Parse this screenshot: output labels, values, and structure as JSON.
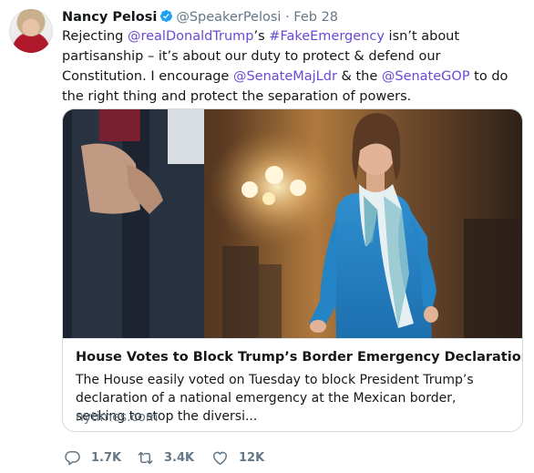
{
  "tweet": {
    "author_name": "Nancy Pelosi",
    "handle": "@SpeakerPelosi",
    "separator": "·",
    "date": "Feb 28",
    "text_parts": {
      "p1": "Rejecting ",
      "mention1": "@realDonaldTrump",
      "p2": "’s ",
      "hashtag": "#FakeEmergency",
      "p3": " isn’t about partisanship – it’s about our duty to protect & defend our Constitution. I encourage ",
      "mention2": "@SenateMajLdr",
      "p4": " & the ",
      "mention3": "@SenateGOP",
      "p5": " to do the right thing and protect the separation of powers."
    }
  },
  "card": {
    "title": "House Votes to Block Trump’s Border Emergency Declaration",
    "description": "The House easily voted on Tuesday to block President Trump’s declaration of a national emergency at the Mexican border, seeking to stop the diversi...",
    "domain": "nytimes.com"
  },
  "actions": {
    "replies": "1.7K",
    "retweets": "3.4K",
    "likes": "12K"
  },
  "colors": {
    "link": "#6a49d6",
    "muted": "#657786",
    "verified": "#1da1f2"
  }
}
